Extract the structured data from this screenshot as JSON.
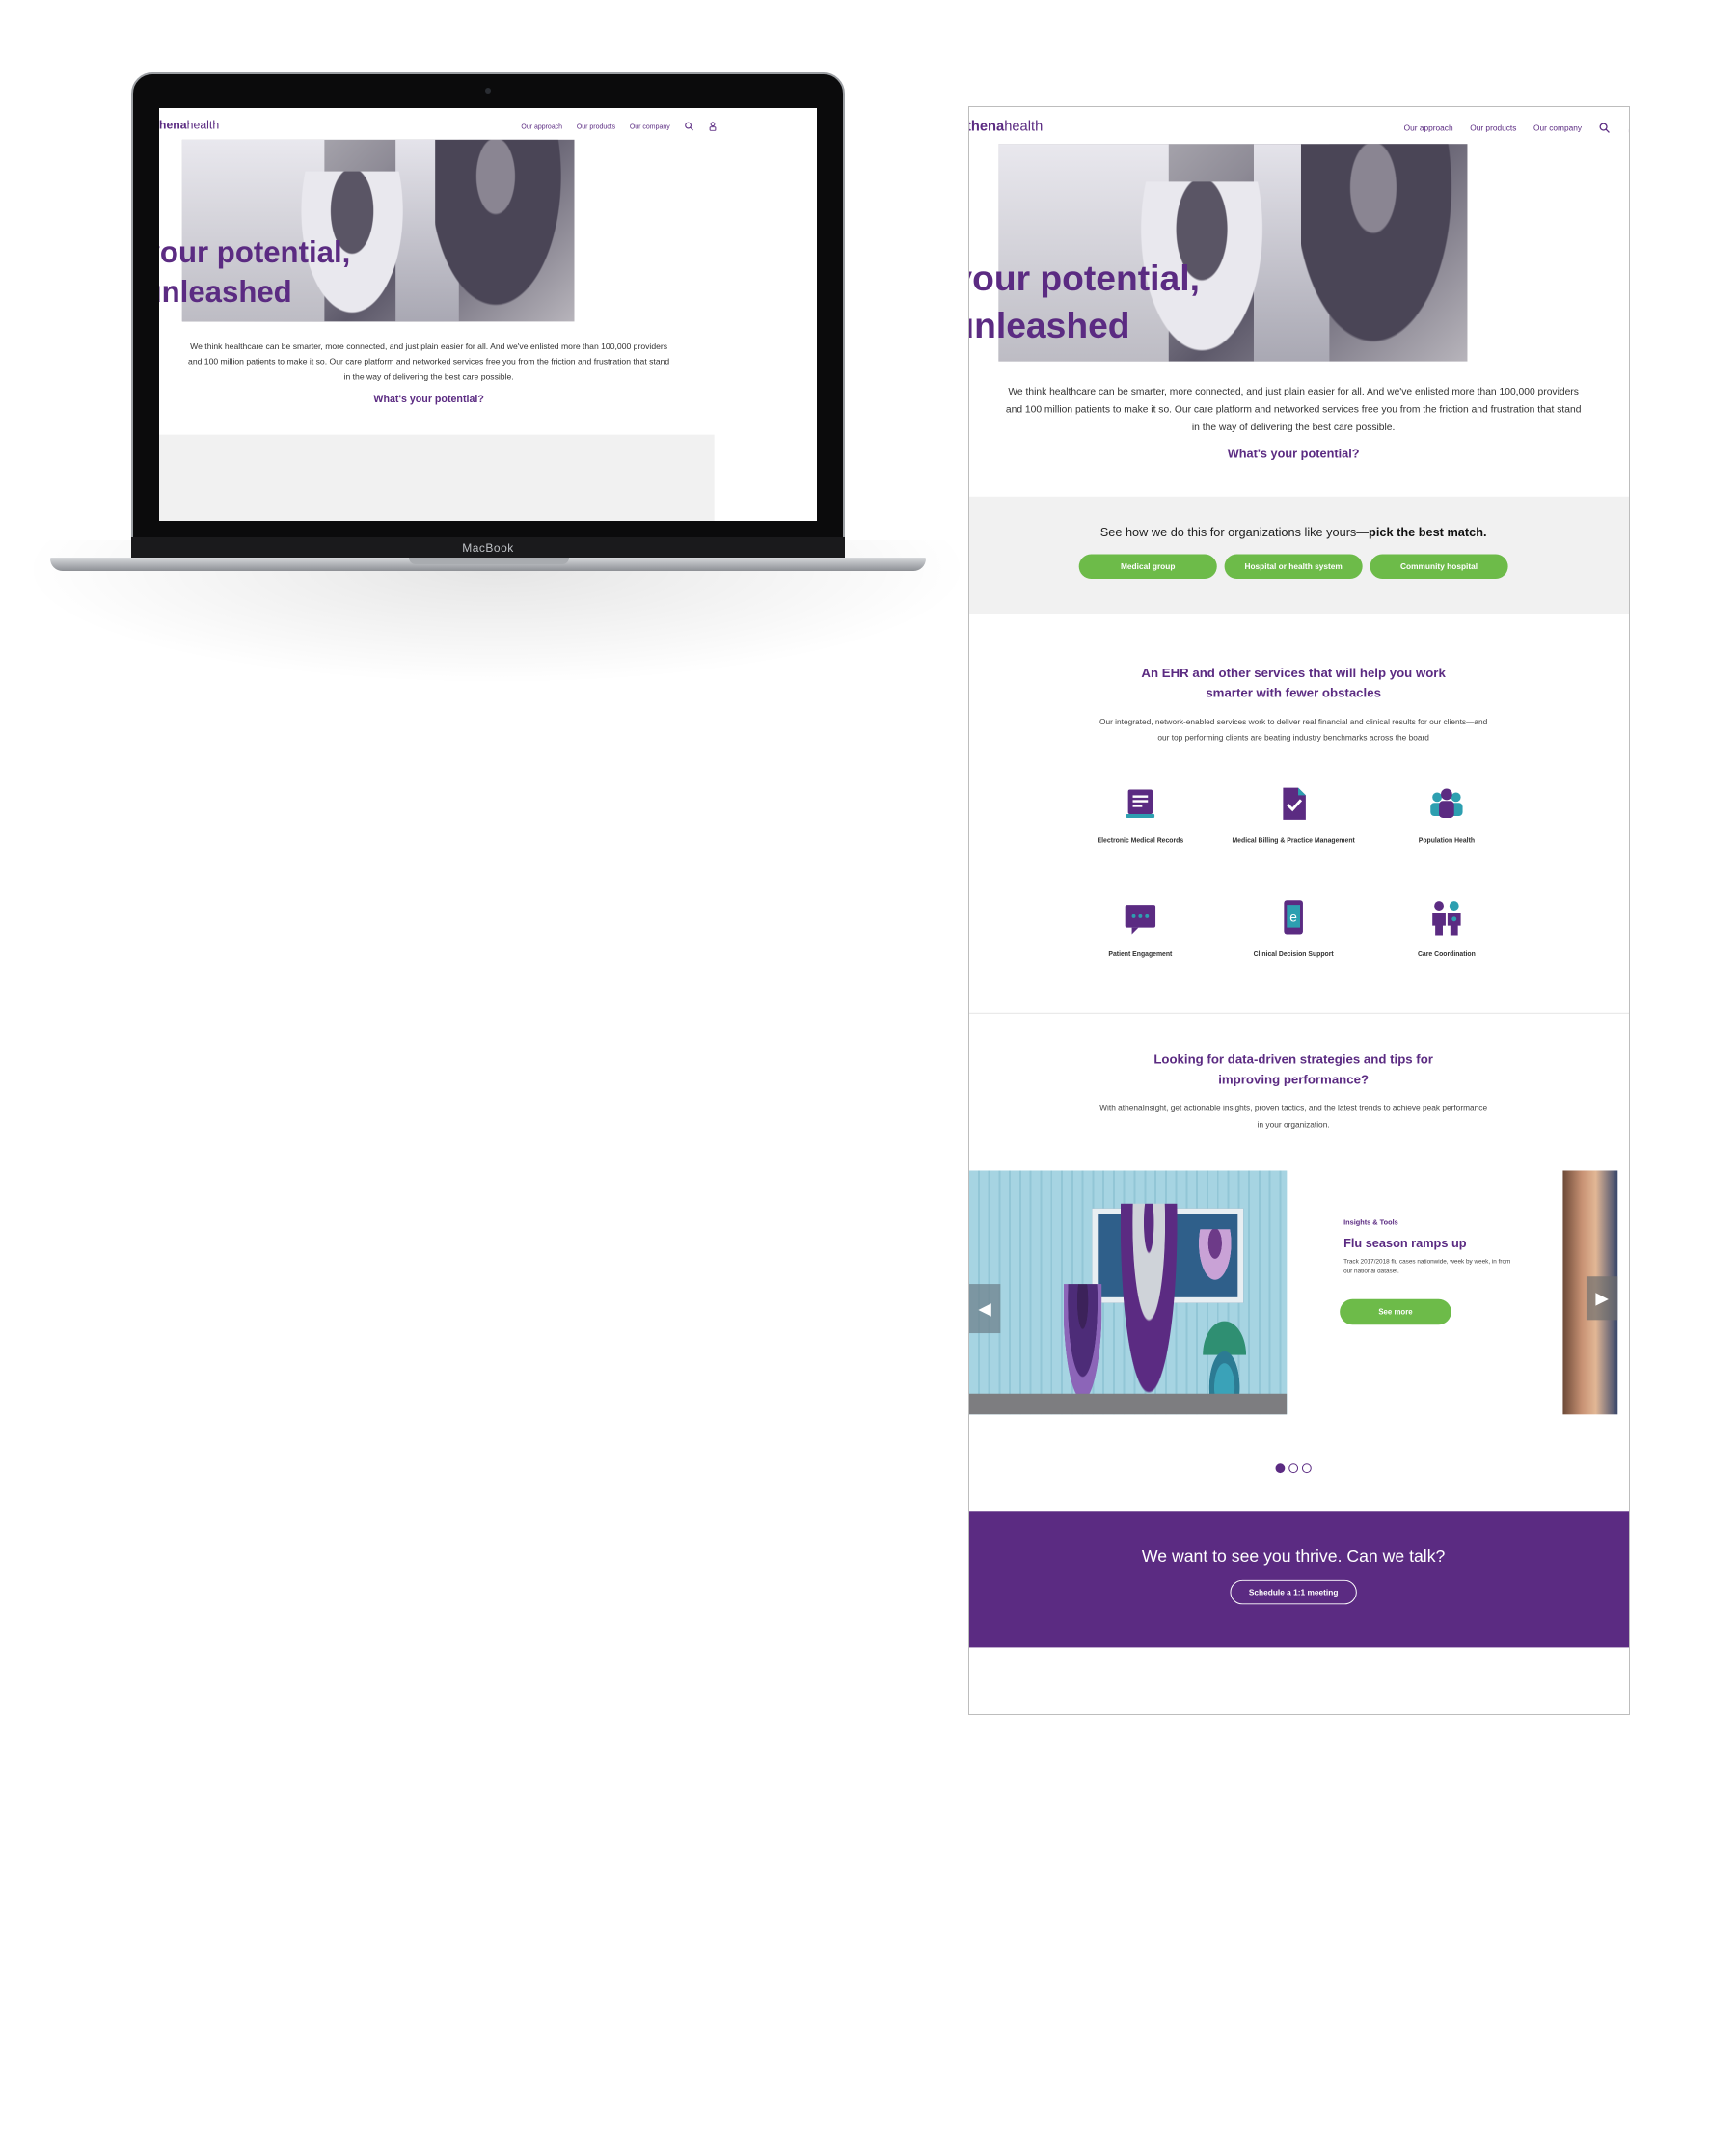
{
  "laptop": {
    "brand": "MacBook"
  },
  "site": {
    "logo": {
      "part1": "athena",
      "part2": "health"
    },
    "nav": {
      "items": [
        "Our approach",
        "Our products",
        "Our company"
      ]
    },
    "hero": {
      "title_line1": "your potential,",
      "title_line2": "unleashed"
    },
    "intro": "We think healthcare can be smarter, more connected, and just plain easier for all. And we've enlisted more than 100,000 providers and 100 million patients to make it so. Our care platform and networked services free you from the friction and frustration that stand in the way of delivering the best care possible.",
    "potential_link": "What's your potential?",
    "match": {
      "text_prefix": "See how we do this for organizations like yours—",
      "text_bold": "pick the best match.",
      "buttons": [
        "Medical group",
        "Hospital or health system",
        "Community hospital"
      ]
    },
    "services": {
      "heading_line1": "An EHR and other services that will help you work",
      "heading_line2": "smarter with fewer obstacles",
      "desc_line1": "Our integrated, network-enabled services work to deliver real financial and clinical results for our clients—and",
      "desc_line2": "our top performing clients are beating industry benchmarks across the board",
      "items": [
        {
          "label": "Electronic Medical Records",
          "icon": "document-icon"
        },
        {
          "label": "Medical Billing & Practice Management",
          "icon": "billing-check-icon"
        },
        {
          "label": "Population Health",
          "icon": "people-group-icon"
        },
        {
          "label": "Patient Engagement",
          "icon": "chat-bubble-icon"
        },
        {
          "label": "Clinical Decision Support",
          "icon": "mobile-e-icon"
        },
        {
          "label": "Care Coordination",
          "icon": "two-people-icon"
        }
      ]
    },
    "insights": {
      "heading_line1": "Looking for data-driven strategies and tips for",
      "heading_line2": "improving performance?",
      "desc_line1": "With athenaInsight, get actionable insights, proven tactics, and the latest trends to achieve peak performance",
      "desc_line2": "in your organization."
    },
    "carousel": {
      "kicker": "Insights & Tools",
      "title": "Flu season ramps up",
      "desc": "Track 2017/2018 flu cases nationwide, week by week, in from our national dataset.",
      "button": "See more",
      "dots": 3,
      "active_dot": 0
    },
    "cta": {
      "title": "We want to see you thrive. Can we talk?",
      "button": "Schedule a 1:1 meeting"
    }
  },
  "colors": {
    "purple": "#5b2b82",
    "green": "#6dbb49",
    "leaf": "#7bb531",
    "grey_box": "#f1f1f1"
  }
}
